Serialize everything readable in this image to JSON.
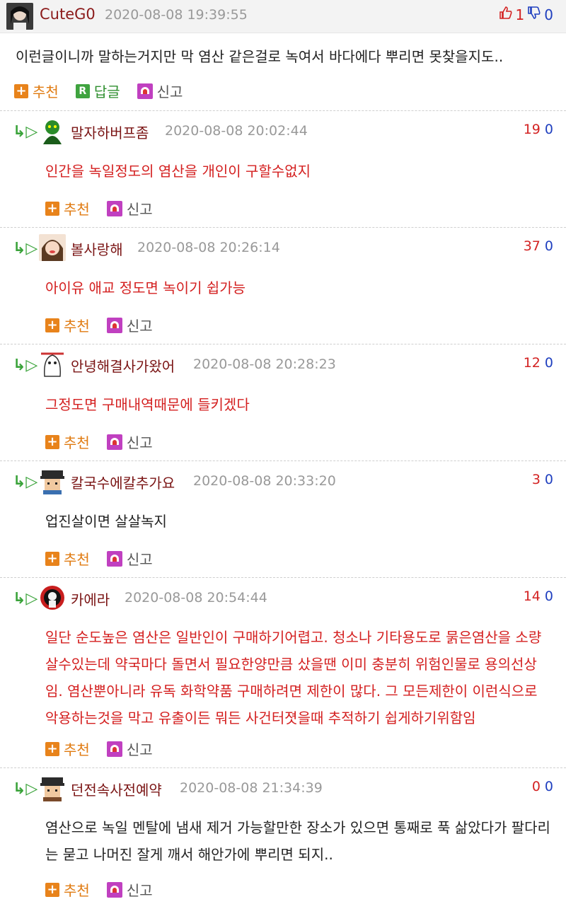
{
  "main": {
    "nick": "CuteG0",
    "date": "2020-08-08 19:39:55",
    "up": "1",
    "down": "0",
    "text": "이런글이니까 말하는거지만 막 염산 같은걸로 녹여서 바다에다 뿌리면 못찾을지도..",
    "actions": {
      "recommend": "추천",
      "reply": "답글",
      "report": "신고"
    }
  },
  "replies": [
    {
      "nick": "말자하버프좀",
      "date": "2020-08-08 20:02:44",
      "up": "19",
      "down": "0",
      "text": "인간을 녹일정도의 염산을 개인이 구할수없지",
      "color": "red"
    },
    {
      "nick": "볼사랑해",
      "date": "2020-08-08 20:26:14",
      "up": "37",
      "down": "0",
      "text": "아이유 애교 정도면 녹이기 쉽가능",
      "color": "red"
    },
    {
      "nick": "안녕해결사가왔어",
      "date": "2020-08-08 20:28:23",
      "up": "12",
      "down": "0",
      "text": "그정도면 구매내역때문에 들키겠다",
      "color": "red"
    },
    {
      "nick": "칼국수에칼추가요",
      "date": "2020-08-08 20:33:20",
      "up": "3",
      "down": "0",
      "text": "업진살이면 살살녹지",
      "color": "dark"
    },
    {
      "nick": "카에라",
      "date": "2020-08-08 20:54:44",
      "up": "14",
      "down": "0",
      "text": "일단 순도높은 염산은 일반인이 구매하기어렵고. 청소나 기타용도로 묽은염산을 소량살수있는데 약국마다 돌면서 필요한양만큼 샀을땐 이미 충분히 위험인물로 용의선상임. 염산뿐아니라 유독 화학약품 구매하려면 제한이 많다. 그 모든제한이 이런식으로 악용하는것을 막고 유출이든 뭐든 사건터졋을때 추적하기 쉽게하기위함임",
      "color": "red"
    },
    {
      "nick": "던전속사전예약",
      "date": "2020-08-08 21:34:39",
      "up": "0",
      "down": "0",
      "text": "염산으로 녹일 멘탈에 냄새 제거 가능할만한 장소가 있으면 통째로 푹 삶았다가 팔다리는 묻고 나머진 잘게 깨서 해안가에 뿌리면 되지..",
      "color": "dark"
    }
  ],
  "reply_actions": {
    "recommend": "추천",
    "report": "신고"
  },
  "icons": {
    "reply_arrow": "reply-arrow-icon",
    "thumb_up": "thumbs-up-icon",
    "thumb_down": "thumbs-down-icon",
    "recommend": "plus-icon",
    "reply": "r-icon",
    "report": "siren-icon"
  },
  "colors": {
    "accent_red": "#d42020",
    "nick_color": "#7a1414",
    "down_blue": "#1f3fbf",
    "plus_orange": "#e8831b"
  }
}
